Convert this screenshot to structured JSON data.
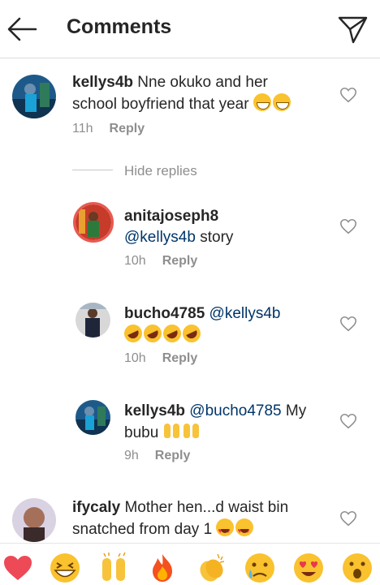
{
  "header": {
    "title": "Comments"
  },
  "comments": [
    {
      "username": "kellys4b",
      "text": "Nne okuko and her",
      "text2": "school boyfriend that year",
      "time": "11h",
      "reply": "Reply"
    },
    {
      "hide_replies": "Hide replies"
    },
    {
      "username": "anitajoseph8",
      "mention": "@kellys4b",
      "text": "story",
      "time": "10h",
      "reply": "Reply"
    },
    {
      "username": "bucho4785",
      "mention": "@kellys4b",
      "time": "10h",
      "reply": "Reply"
    },
    {
      "username": "kellys4b",
      "mention": "@bucho4785",
      "text": "My",
      "text2": "bubu",
      "time": "9h",
      "reply": "Reply"
    },
    {
      "username": "ifycaly",
      "text": "Mother hen...d waist bin",
      "text2": "snatched from day 1"
    }
  ],
  "emoji_bar": [
    "red-heart",
    "grinning-squinting",
    "raising-hands",
    "fire",
    "clapping-hands",
    "confused-face",
    "heart-eyes",
    "open-mouth"
  ],
  "colors": {
    "mention": "#003569",
    "meta": "#8e8e8e",
    "heart": "#ed4956"
  }
}
